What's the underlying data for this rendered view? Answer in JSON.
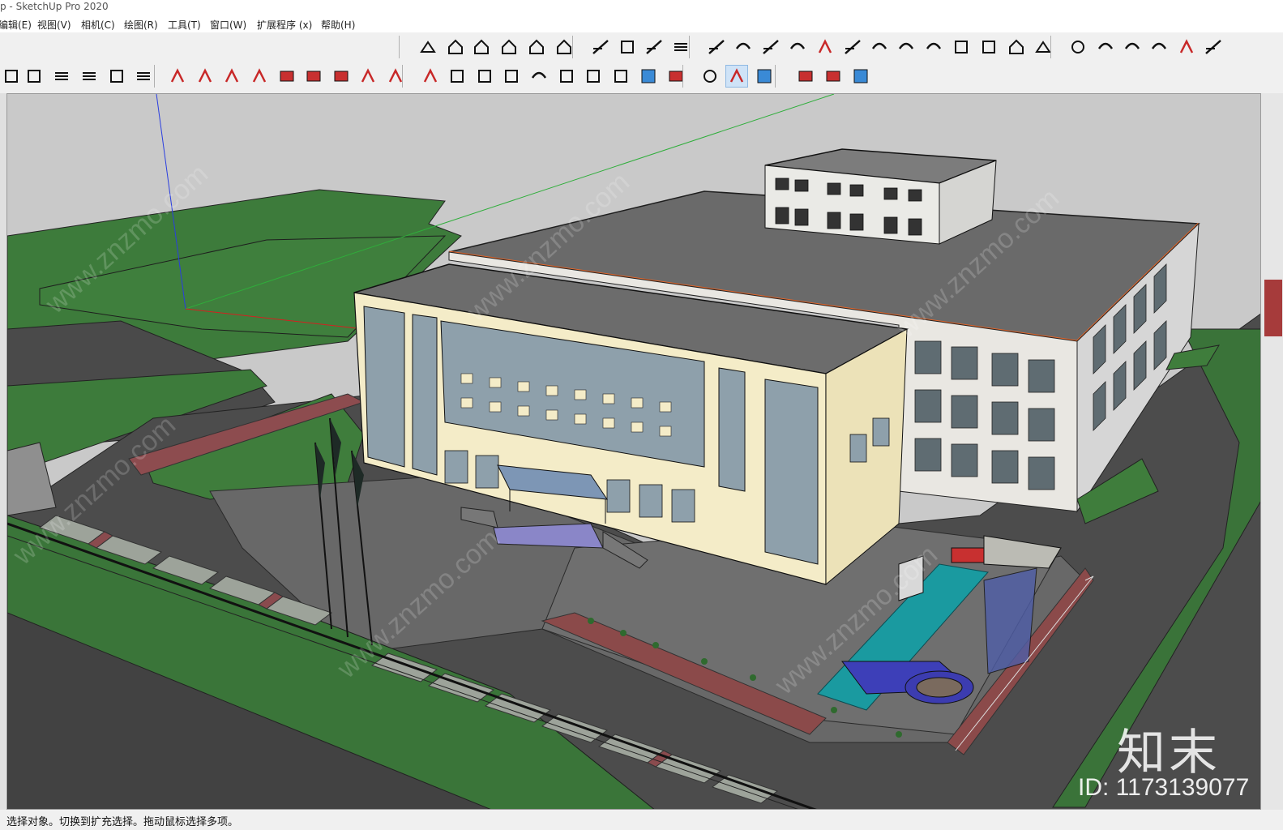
{
  "window": {
    "title": "p - SketchUp Pro 2020"
  },
  "menu": [
    {
      "label": "编辑(E)"
    },
    {
      "label": "视图(V)"
    },
    {
      "label": "相机(C)"
    },
    {
      "label": "绘图(R)"
    },
    {
      "label": "工具(T)"
    },
    {
      "label": "窗口(W)"
    },
    {
      "label": "扩展程序 (x)"
    },
    {
      "label": "帮助(H)"
    }
  ],
  "toolbar_icons": {
    "row1": [
      "warehouse-icon",
      "component-icon",
      "house-icon",
      "open-icon",
      "home-icon",
      "store-icon",
      "stairs-icon",
      "grid-icon",
      "ramp-icon",
      "bars-icon",
      "weld-icon",
      "line-icon",
      "arrow-join-icon",
      "split-icon",
      "arc-icon",
      "rotate-icon",
      "curve-icon",
      "slab-icon",
      "knife-icon",
      "layers-icon",
      "stack-icon",
      "box-icon",
      "bundle-icon",
      "profile-icon",
      "wave-icon",
      "spring-icon",
      "pencil-icon",
      "fence-icon",
      "column-icon"
    ],
    "row2": [
      "cube-icon",
      "frame-icon",
      "grille-icon",
      "grille-red-icon",
      "book-icon",
      "ruler-icon",
      "red-check-icon",
      "pen-icon",
      "draw-icon",
      "curve2-icon",
      "plane-icon",
      "red-box-icon",
      "nodes-icon",
      "lines-icon",
      "sheet-icon",
      "box3d-icon",
      "tent-icon",
      "stamp-icon",
      "bend-icon",
      "sign-icon",
      "book2-icon",
      "edit-icon",
      "pan-icon",
      "target-icon",
      "measure-icon",
      "b-icon",
      "su-red-icon",
      "su-app-icon",
      "step-icon",
      "paint-icon",
      "check-shield-icon"
    ]
  },
  "statusbar": {
    "text": "选择对象。切换到扩充选择。拖动鼠标选择多项。"
  },
  "watermark": {
    "brand": "知末",
    "id": "ID: 1173139077",
    "site": "www.znzmo.com"
  },
  "colors": {
    "lawn": "#3f7a3c",
    "road": "#4a4a4a",
    "facade": "#f4ecc8",
    "roof": "#6e6e6e",
    "glass": "#9fb2bf",
    "accent_orange": "#e0652a"
  }
}
